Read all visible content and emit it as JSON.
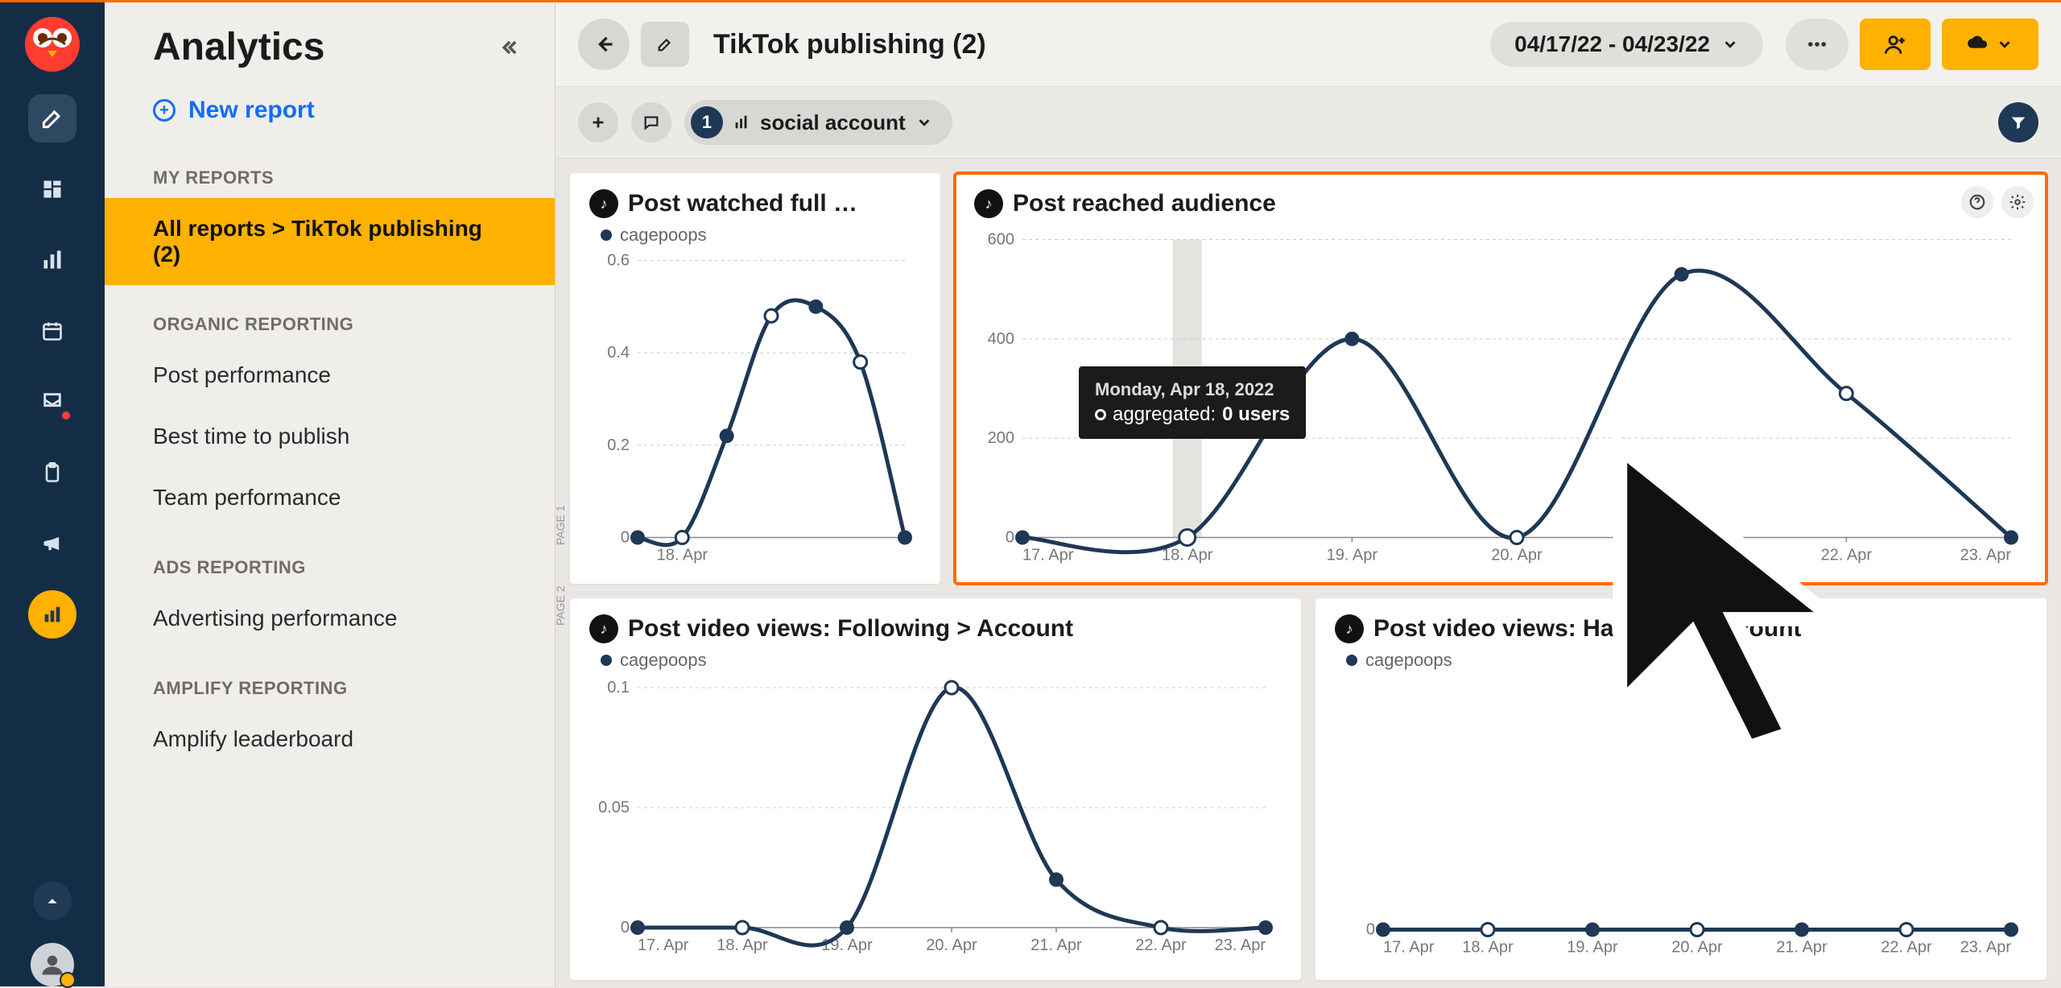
{
  "app": {
    "title": "Analytics"
  },
  "sidebar": {
    "new_report": "New report",
    "sections": {
      "my_reports": "MY REPORTS",
      "organic": "ORGANIC REPORTING",
      "ads": "ADS REPORTING",
      "amplify": "AMPLIFY REPORTING"
    },
    "active_crumb_prefix": "All reports > ",
    "active_crumb_name": "TikTok publishing (2)",
    "items": {
      "post_perf": "Post performance",
      "best_time": "Best time to publish",
      "team_perf": "Team performance",
      "ad_perf": "Advertising performance",
      "amp_lead": "Amplify leaderboard"
    }
  },
  "header": {
    "page_title": "TikTok publishing (2)",
    "daterange": "04/17/22 - 04/23/22"
  },
  "subbar": {
    "account_count": "1",
    "account_label": "social account"
  },
  "page_labels": {
    "p1": "PAGE 1",
    "p2": "PAGE 2"
  },
  "cards": {
    "watched": {
      "title": "Post watched full …",
      "legend": "cagepoops"
    },
    "reached": {
      "title": "Post reached audience",
      "tooltip_date": "Monday, Apr 18, 2022",
      "tooltip_metric": "aggregated: ",
      "tooltip_value": "0 users"
    },
    "following": {
      "title": "Post video views: Following > Account",
      "legend": "cagepoops"
    },
    "hashtag": {
      "title": "Post video views: Hashtag > Account",
      "legend": "cagepoops"
    }
  },
  "chart_data": [
    {
      "id": "watched",
      "type": "line",
      "title": "Post watched full …",
      "xlabel": "",
      "ylabel": "",
      "categories": [
        "17. Apr",
        "18. Apr",
        "19. Apr",
        "20. Apr",
        "21. Apr",
        "22. Apr",
        "23. Apr"
      ],
      "series": [
        {
          "name": "cagepoops",
          "values": [
            0,
            0,
            0.22,
            0.48,
            0.5,
            0.38,
            0
          ]
        }
      ],
      "ylim": [
        0,
        0.6
      ],
      "yticks": [
        0,
        0.2,
        0.4,
        0.6
      ],
      "xticks_shown": [
        "18. Apr"
      ],
      "open_point_indices": [
        1,
        3,
        5
      ]
    },
    {
      "id": "reached",
      "type": "line",
      "title": "Post reached audience",
      "xlabel": "",
      "ylabel": "",
      "categories": [
        "17. Apr",
        "18. Apr",
        "19. Apr",
        "20. Apr",
        "21. Apr",
        "22. Apr",
        "23. Apr"
      ],
      "series": [
        {
          "name": "aggregated",
          "values": [
            0,
            0,
            400,
            0,
            530,
            290,
            0
          ]
        }
      ],
      "ylim": [
        0,
        600
      ],
      "yticks": [
        0,
        200,
        400,
        600
      ],
      "xticks_shown": [
        "17. Apr",
        "18. Apr",
        "19. Apr",
        "20. Apr",
        "21. Apr",
        "22. Apr",
        "23. Apr"
      ],
      "open_point_indices": [
        1,
        3,
        5
      ],
      "highlight_index": 1,
      "tooltip": {
        "index": 1,
        "date": "Monday, Apr 18, 2022",
        "label": "aggregated",
        "value": "0 users"
      }
    },
    {
      "id": "following",
      "type": "line",
      "title": "Post video views: Following > Account",
      "categories": [
        "17. Apr",
        "18. Apr",
        "19. Apr",
        "20. Apr",
        "21. Apr",
        "22. Apr",
        "23. Apr"
      ],
      "series": [
        {
          "name": "cagepoops",
          "values": [
            0,
            0,
            0,
            0.1,
            0.02,
            0,
            0
          ]
        }
      ],
      "ylim": [
        0,
        0.1
      ],
      "yticks": [
        0,
        0.05,
        0.1
      ],
      "xticks_shown": [
        "17. Apr",
        "18. Apr",
        "19. Apr",
        "20. Apr",
        "21. Apr",
        "22. Apr",
        "23. Apr"
      ],
      "open_point_indices": [
        1,
        3,
        5
      ]
    },
    {
      "id": "hashtag",
      "type": "line",
      "title": "Post video views: Hashtag > Account",
      "categories": [
        "17. Apr",
        "18. Apr",
        "19. Apr",
        "20. Apr",
        "21. Apr",
        "22. Apr",
        "23. Apr"
      ],
      "series": [
        {
          "name": "cagepoops",
          "values": [
            0,
            0,
            0,
            0,
            0,
            0,
            0
          ]
        }
      ],
      "ylim": [
        0,
        1
      ],
      "yticks": [
        0
      ],
      "xticks_shown": [
        "17. Apr",
        "18. Apr",
        "19. Apr",
        "20. Apr",
        "21. Apr",
        "22. Apr",
        "23. Apr"
      ],
      "open_point_indices": [
        1,
        3,
        5
      ]
    }
  ],
  "colors": {
    "brand_red": "#ff3c2f",
    "brand_amber": "#ffb100",
    "nav_dark": "#142d47",
    "accent_orange": "#ff6a00",
    "series": "#1e3855"
  }
}
